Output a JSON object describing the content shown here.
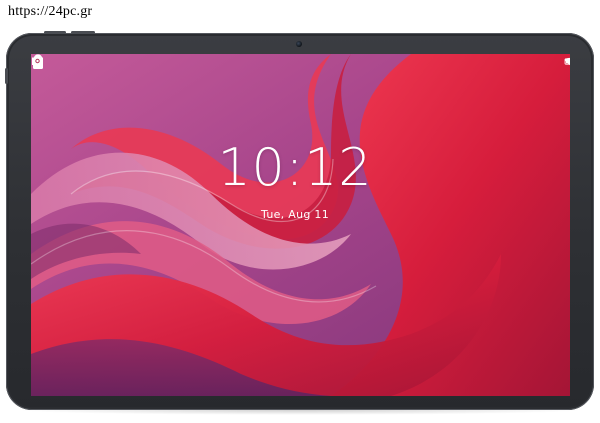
{
  "watermark": {
    "text": "https://24pc.gr"
  },
  "device": {
    "bezel_color": "#2e3034",
    "screen_accent": "#e02640"
  },
  "status_bar": {
    "icons": [
      "wifi-icon",
      "battery-icon"
    ]
  },
  "lock_screen": {
    "lock_icon": "lock-icon",
    "time": "10:12",
    "date": "Tue, Aug 11",
    "camera_shortcut_icon": "camera-icon"
  }
}
